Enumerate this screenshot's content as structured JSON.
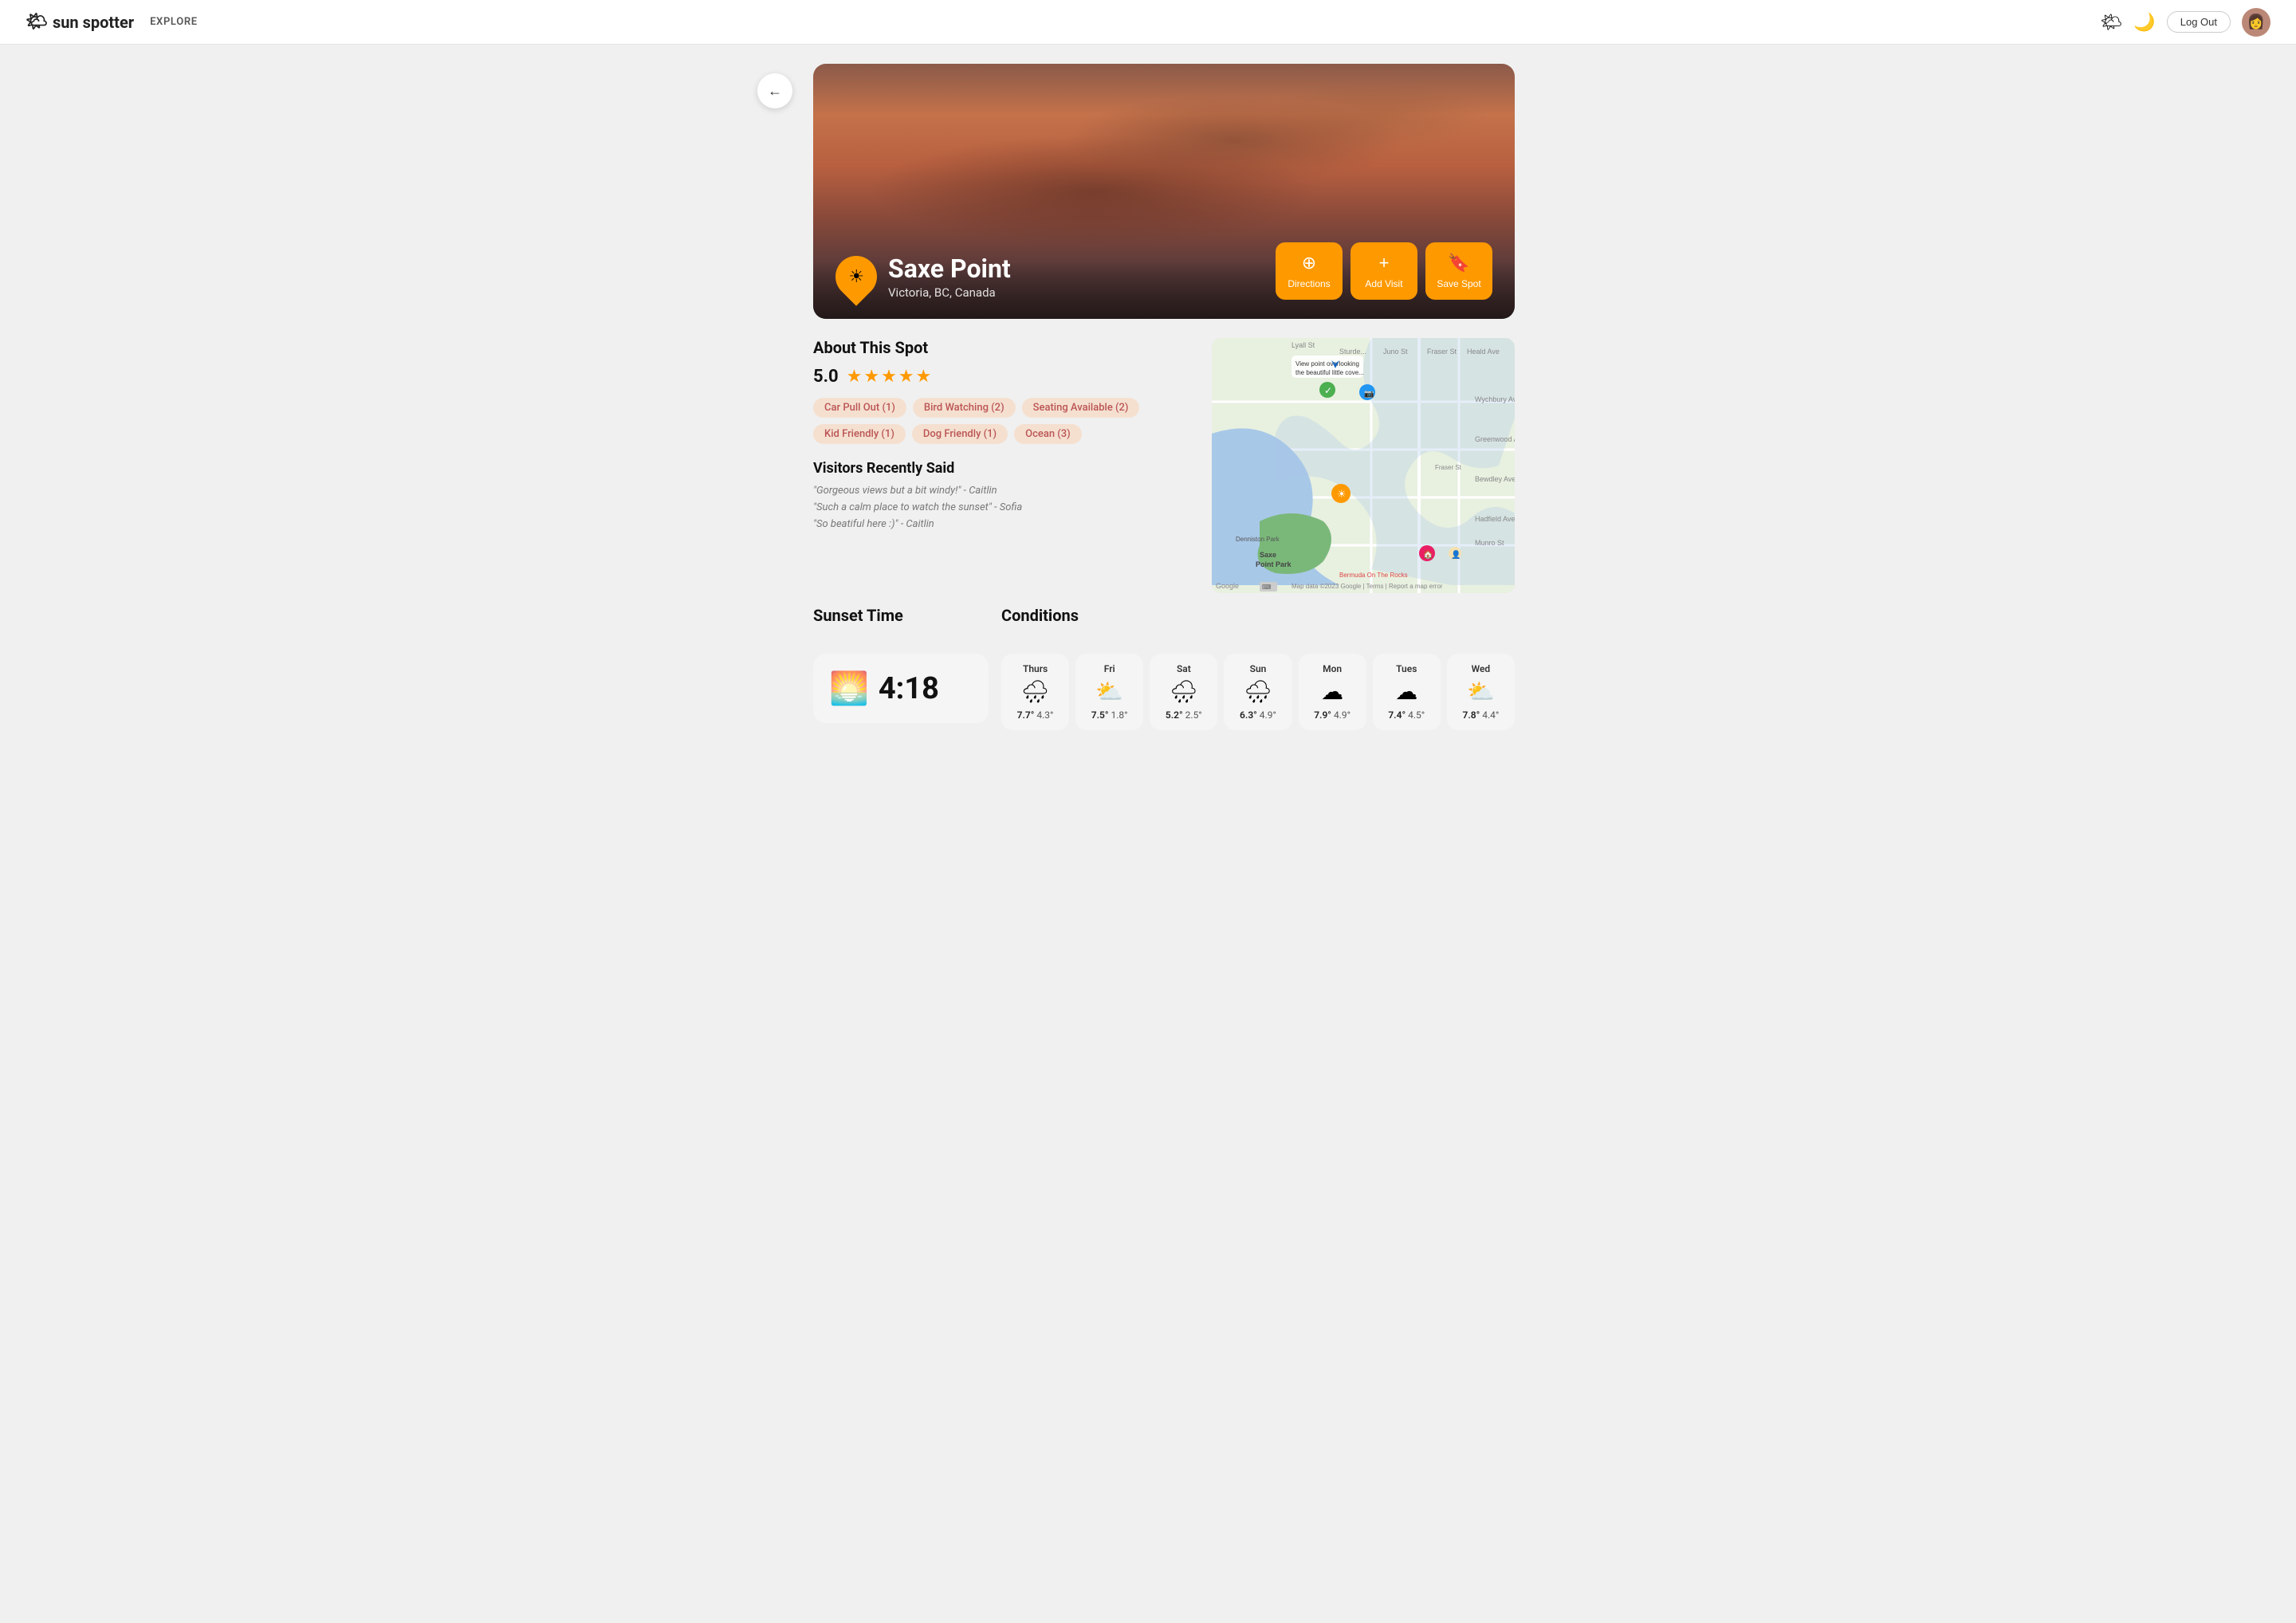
{
  "header": {
    "logo_text": "sun spotter",
    "logo_sun": "☀",
    "nav_label": "EXPLORE",
    "logout_label": "Log Out",
    "sun_icon": "🌤",
    "moon_icon": "🌙"
  },
  "back_button": "←",
  "hero": {
    "location_name": "Saxe Point",
    "location_subtitle": "Victoria, BC, Canada",
    "actions": [
      {
        "id": "directions",
        "label": "Directions",
        "icon": "⊕"
      },
      {
        "id": "add-visit",
        "label": "Add Visit",
        "icon": "+"
      },
      {
        "id": "save-spot",
        "label": "Save Spot",
        "icon": "🔖"
      }
    ]
  },
  "about": {
    "title": "About This Spot",
    "rating": "5.0",
    "tags": [
      "Car Pull Out (1)",
      "Bird Watching (2)",
      "Seating Available (2)",
      "Kid Friendly (1)",
      "Dog Friendly (1)",
      "Ocean (3)"
    ]
  },
  "reviews": {
    "title": "Visitors Recently Said",
    "items": [
      "\"Gorgeous views but a bit windy!\" - Caitlin",
      "\"Such a calm place to watch the sunset\" - Sofia",
      "\"So beatiful here :)\" - Caitlin"
    ]
  },
  "sunset": {
    "section_title": "Sunset Time",
    "time": "4:18",
    "icon": "🌅"
  },
  "conditions": {
    "section_title": "Conditions",
    "days": [
      {
        "day": "Thurs",
        "icon": "🌧",
        "high": "7.7°",
        "low": "4.3°"
      },
      {
        "day": "Fri",
        "icon": "⛅",
        "high": "7.5°",
        "low": "1.8°"
      },
      {
        "day": "Sat",
        "icon": "🌧",
        "high": "5.2°",
        "low": "2.5°"
      },
      {
        "day": "Sun",
        "icon": "🌧",
        "high": "6.3°",
        "low": "4.9°"
      },
      {
        "day": "Mon",
        "icon": "☁",
        "high": "7.9°",
        "low": "4.9°"
      },
      {
        "day": "Tues",
        "icon": "☁",
        "high": "7.4°",
        "low": "4.5°"
      },
      {
        "day": "Wed",
        "icon": "⛅",
        "high": "7.8°",
        "low": "4.4°"
      }
    ]
  }
}
